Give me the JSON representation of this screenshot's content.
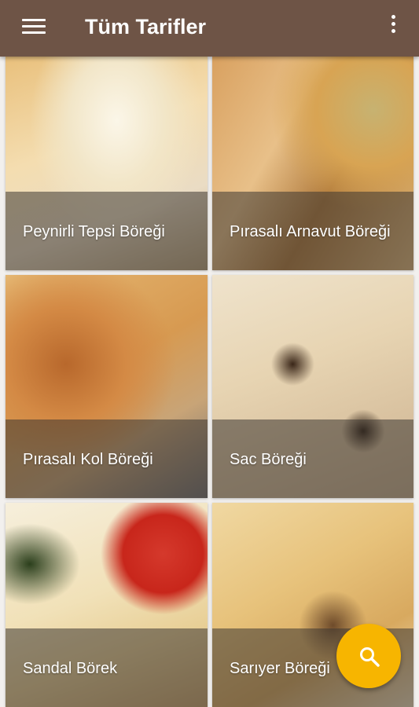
{
  "appbar": {
    "title": "Tüm Tarifler",
    "color": "#6e5446",
    "menu_icon": "hamburger-menu-icon",
    "more_icon": "more-vertical-icon"
  },
  "recipes": [
    {
      "name": "Peynirli Tepsi Böreği"
    },
    {
      "name": "Pırasalı Arnavut Böreği"
    },
    {
      "name": "Pırasalı Kol Böreği"
    },
    {
      "name": "Sac Böreği"
    },
    {
      "name": "Sandal Börek"
    },
    {
      "name": "Sarıyer Böreği"
    }
  ],
  "fab": {
    "icon": "search-icon",
    "color": "#f7b500"
  }
}
